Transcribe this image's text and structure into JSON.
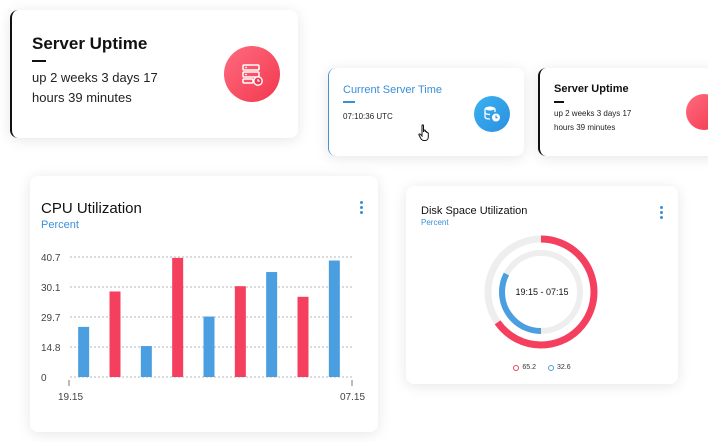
{
  "uptime_card_main": {
    "title": "Server Uptime",
    "line1": "up 2 weeks 3 days 17",
    "line2": "hours 39 minutes",
    "icon": "server-clock-icon"
  },
  "server_time_card": {
    "title": "Current Server Time",
    "value": "07:10:36 UTC",
    "icon": "database-clock-icon"
  },
  "uptime_card_small": {
    "title": "Server Uptime",
    "line1": "up 2 weeks 3 days 17",
    "line2": "hours 39 minutes",
    "icon": "server-clock-icon"
  },
  "cpu_card": {
    "title": "CPU Utilization",
    "subtitle": "Percent",
    "menu_icon": "more-vertical-icon"
  },
  "disk_card": {
    "title": "Disk Space Utilization",
    "subtitle": "Percent",
    "center_label": "19:15 - 07:15",
    "menu_icon": "more-vertical-icon",
    "legend": [
      {
        "label": "65.2",
        "color": "#f43f5e"
      },
      {
        "label": "32.6",
        "color": "#4b9fe0"
      }
    ]
  },
  "colors": {
    "red": "#f43f5e",
    "blue": "#4b9fe0",
    "accent": "#3a8fd9"
  },
  "chart_data": [
    {
      "type": "bar",
      "title": "CPU Utilization",
      "subtitle": "Percent",
      "y_tick_labels": [
        "0",
        "14.8",
        "29.7",
        "30.1",
        "40.7"
      ],
      "x_tick_labels": [
        "19.15",
        "07.15"
      ],
      "ylim": [
        0,
        40.7
      ],
      "grid": true,
      "bars": [
        {
          "value": 17,
          "color": "blue"
        },
        {
          "value": 29,
          "color": "red"
        },
        {
          "value": 10.5,
          "color": "blue"
        },
        {
          "value": 40.4,
          "color": "red"
        },
        {
          "value": 20.5,
          "color": "blue"
        },
        {
          "value": 30.8,
          "color": "red"
        },
        {
          "value": 35.6,
          "color": "blue"
        },
        {
          "value": 27.2,
          "color": "red"
        },
        {
          "value": 39.5,
          "color": "blue"
        }
      ]
    },
    {
      "type": "pie",
      "title": "Disk Space Utilization",
      "subtitle": "Percent",
      "center_label": "19:15 - 07:15",
      "rings": [
        {
          "label": "65.2",
          "value": 65.2,
          "color": "#f43f5e"
        },
        {
          "label": "32.6",
          "value": 32.6,
          "color": "#4b9fe0"
        }
      ]
    }
  ]
}
